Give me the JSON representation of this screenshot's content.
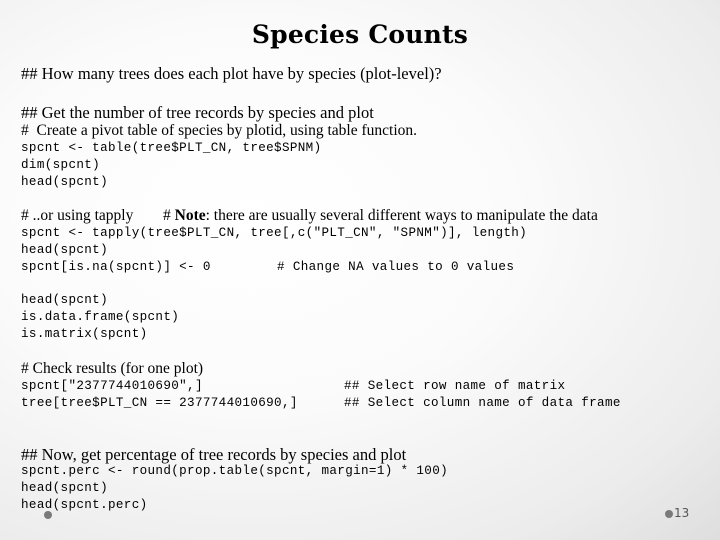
{
  "slide": {
    "title": "Species Counts",
    "question": "## How many trees does each plot have by species (plot-level)?",
    "section1": {
      "heading": "## Get the number of tree records by species and plot",
      "comment": "#  Create a pivot table of species by plotid, using table function.",
      "code": [
        "spcnt <- table(tree$PLT_CN, tree$SPNM)",
        "dim(spcnt)",
        "head(spcnt)"
      ]
    },
    "section2": {
      "comment_prefix": "# ..or using tapply",
      "note_hash": "# ",
      "note_bold": "Note",
      "note_rest": ": there are usually several different ways to manipulate the data",
      "code": [
        "spcnt <- tapply(tree$PLT_CN, tree[,c(\"PLT_CN\", \"SPNM\")], length)",
        "head(spcnt)",
        "spcnt[is.na(spcnt)] <- 0"
      ],
      "inline_comment": "# Change NA values to 0 values"
    },
    "section3": {
      "code": [
        "head(spcnt)",
        "is.data.frame(spcnt)",
        "is.matrix(spcnt)"
      ]
    },
    "section4": {
      "comment": "# Check results (for one plot)",
      "code": [
        "spcnt[\"2377744010690\",]",
        "tree[tree$PLT_CN == 2377744010690,]"
      ],
      "inline_comments": [
        "## Select row name of matrix",
        "## Select column name of data frame"
      ]
    },
    "section5": {
      "heading": "## Now, get percentage of tree records by species and plot",
      "code": [
        "spcnt.perc <- round(prop.table(spcnt, margin=1) * 100)",
        "head(spcnt)",
        "head(spcnt.perc)"
      ]
    },
    "page_number": "13"
  }
}
